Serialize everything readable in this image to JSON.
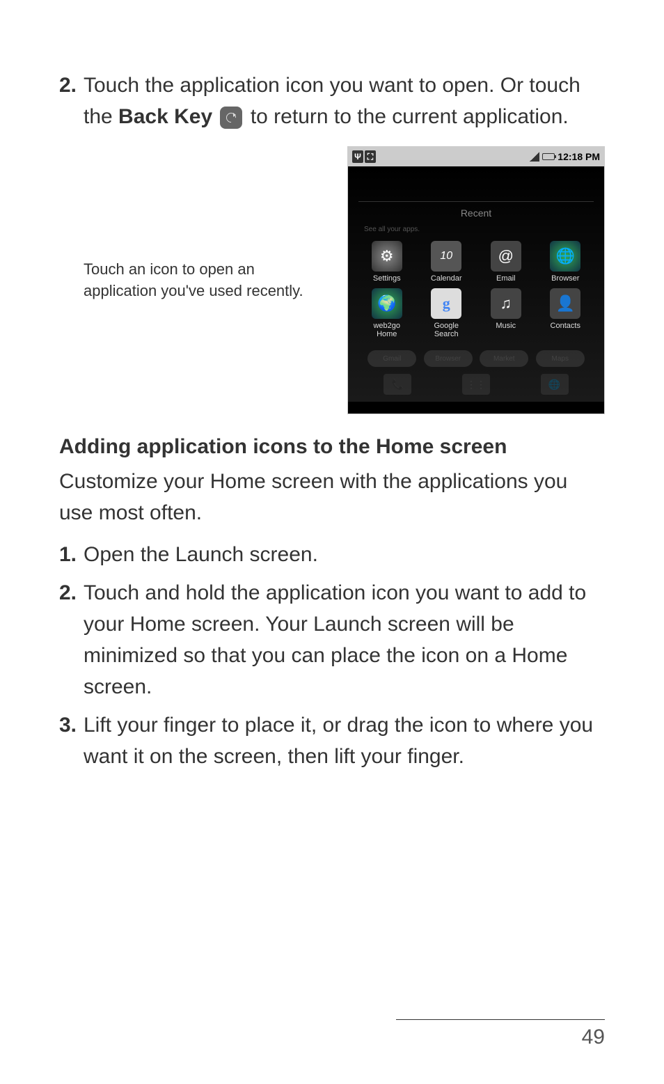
{
  "step2_num": "2.",
  "step2_text_a": "Touch the application icon you want to open. Or touch the ",
  "step2_bold": "Back Key",
  "step2_text_b": " to return to the current application.",
  "callout_line1": "Touch an icon to open an",
  "callout_line2": "application you've used recently.",
  "status_time": "12:18 PM",
  "recent_label": "Recent",
  "see_apps_label": "See all your apps.",
  "apps": {
    "settings": {
      "label": "Settings",
      "glyph": "⚙"
    },
    "calendar": {
      "label": "Calendar",
      "glyph": "10"
    },
    "email": {
      "label": "Email",
      "glyph": "@"
    },
    "browser": {
      "label": "Browser",
      "glyph": "🌐"
    },
    "web2go": {
      "label": "web2go\nHome",
      "glyph": "🌍"
    },
    "google": {
      "label": "Google\nSearch",
      "glyph": "g"
    },
    "music": {
      "label": "Music",
      "glyph": "♫"
    },
    "contacts": {
      "label": "Contacts",
      "glyph": "👤"
    }
  },
  "faded": [
    "Gmail",
    "Browser",
    "Market",
    "Maps"
  ],
  "heading": "Adding application icons to the Home screen",
  "body": "Customize your Home screen with the applications you use most often.",
  "step_a_num": "1.",
  "step_a": " Open the Launch screen.",
  "step_b_num": "2.",
  "step_b": "Touch and hold the application icon you want to add to your Home screen. Your Launch screen will be minimized so that you can place the icon on a Home screen.",
  "step_c_num": "3.",
  "step_c": "Lift your finger to place it, or drag the icon to where you want it on the screen, then lift your finger.",
  "page_number": "49"
}
